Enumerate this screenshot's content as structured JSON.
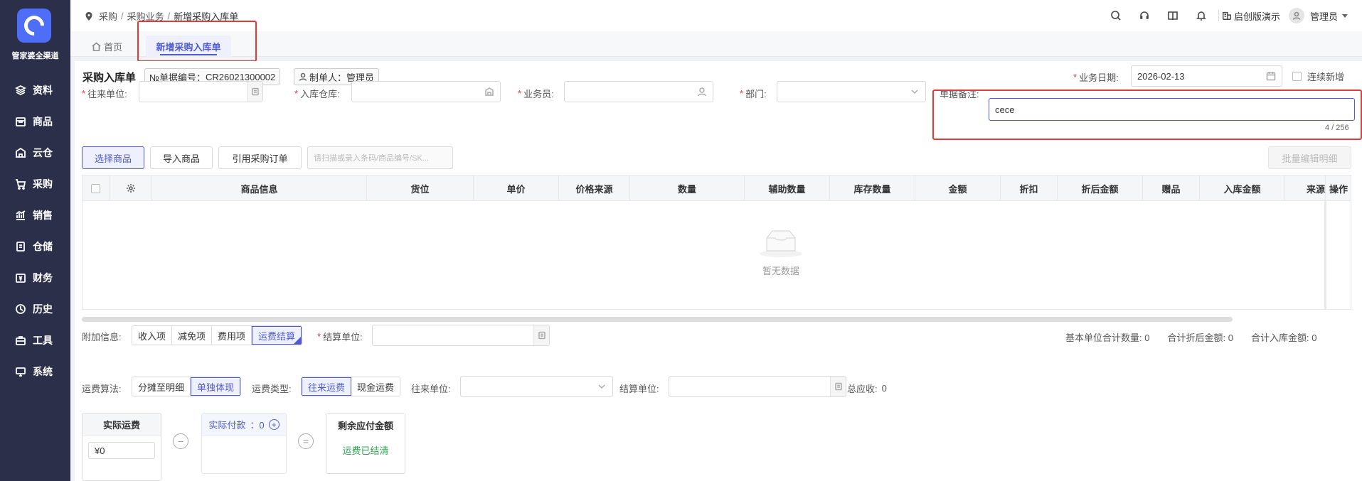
{
  "app": {
    "brand": "管家婆全渠道"
  },
  "sidebar": {
    "items": [
      {
        "label": "资料",
        "icon": "layers-icon"
      },
      {
        "label": "商品",
        "icon": "box-icon"
      },
      {
        "label": "云仓",
        "icon": "warehouse-icon"
      },
      {
        "label": "采购",
        "icon": "cart-icon"
      },
      {
        "label": "销售",
        "icon": "sales-chart-icon"
      },
      {
        "label": "仓储",
        "icon": "storage-icon"
      },
      {
        "label": "财务",
        "icon": "money-icon"
      },
      {
        "label": "历史",
        "icon": "clock-icon"
      },
      {
        "label": "工具",
        "icon": "toolbox-icon"
      },
      {
        "label": "系统",
        "icon": "monitor-icon"
      }
    ]
  },
  "header": {
    "breadcrumb": [
      "采购",
      "采购业务",
      "新增采购入库单"
    ],
    "company": "启创版演示",
    "user": "管理员"
  },
  "tabs": {
    "home": "首页",
    "active": "新增采购入库单"
  },
  "form": {
    "title": "采购入库单",
    "doc_no_label": "№单据编号：",
    "doc_no": "CR26021300002",
    "maker_label": "制单人：",
    "maker": "管理员",
    "date_label": "业务日期:",
    "date": "2026-02-13",
    "continue_label": "连续新增",
    "partner_label": "往来单位:",
    "warehouse_label": "入库仓库:",
    "salesman_label": "业务员:",
    "dept_label": "部门:",
    "remark_label": "单据备注:",
    "remark_value": "cece",
    "remark_count": "4 / 256"
  },
  "toolbar": {
    "select_goods": "选择商品",
    "import_goods": "导入商品",
    "ref_order": "引用采购订单",
    "scan_placeholder": "请扫描或录入条码/商品编号/SK...",
    "batch_edit": "批量编辑明细"
  },
  "table": {
    "columns": [
      "商品信息",
      "货位",
      "单价",
      "价格来源",
      "数量",
      "辅助数量",
      "库存数量",
      "金额",
      "折扣",
      "折后金额",
      "赠品",
      "入库金额",
      "来源",
      "操作"
    ],
    "empty_text": "暂无数据"
  },
  "extra": {
    "label": "附加信息:",
    "tabs": [
      "收入项",
      "减免项",
      "费用项",
      "运费结算"
    ],
    "active_tab": "运费结算",
    "settle_unit_label": "结算单位:",
    "stats": {
      "base_qty_label": "基本单位合计数量:",
      "base_qty": "0",
      "discount_amount_label": "合计折后金额:",
      "discount_amount": "0",
      "in_amount_label": "合计入库金额:",
      "in_amount": "0"
    }
  },
  "freight": {
    "algo_label": "运费算法:",
    "algo_options": [
      "分摊至明细",
      "单独体现"
    ],
    "algo_selected": "单独体现",
    "type_label": "运费类型:",
    "type_options": [
      "往来运费",
      "现金运费"
    ],
    "type_selected": "往来运费",
    "partner_label": "往来单位:",
    "settle_label": "结算单位:",
    "receivable_label": "总应收:",
    "receivable": "0",
    "actual_freight_title": "实际运费",
    "actual_freight_value": "¥0",
    "actual_payment_title": "实际付款",
    "actual_payment_value": "：0",
    "remaining_title": "剩余应付金额",
    "remaining_status": "运费已结清",
    "minus": "−",
    "equals": "="
  },
  "colors": {
    "sidebar": "#2b2f4a",
    "accent": "#4f5bd5",
    "highlight": "#e53935",
    "success": "#2ea44f"
  }
}
